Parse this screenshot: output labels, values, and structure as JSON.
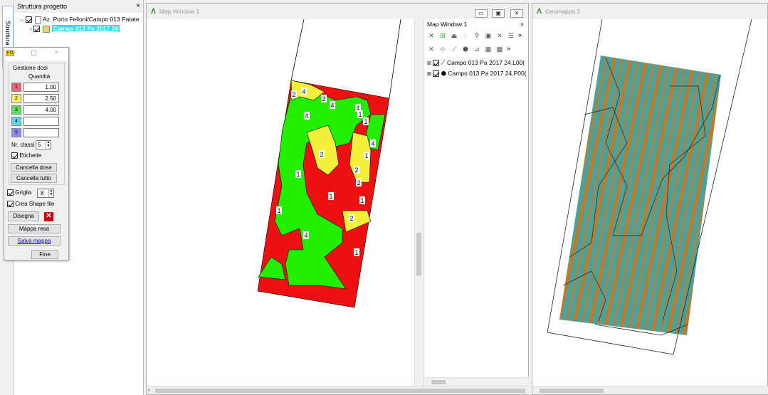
{
  "sidebar_tab": {
    "label": "Struttura p"
  },
  "project_panel": {
    "title": "Struttura progetto",
    "close": "×",
    "tree": [
      {
        "label": "Az. Porto Felloni/Campo 013 Patate"
      },
      {
        "label": "Campo 013 Pa 2017 24"
      }
    ]
  },
  "dose_dialog": {
    "badge": "FO",
    "group_title": "Gestione dosi",
    "qty_header": "Quantità",
    "classes": [
      {
        "n": "1",
        "color": "#e8657a",
        "value": "1.00"
      },
      {
        "n": "2",
        "color": "#f5f066",
        "value": "2.50"
      },
      {
        "n": "3",
        "color": "#5ee05e",
        "value": "4.00"
      },
      {
        "n": "4",
        "color": "#5dd8e8",
        "value": ""
      },
      {
        "n": "5",
        "color": "#8c8cf0",
        "value": ""
      }
    ],
    "nr_classi_label": "Nr. classi",
    "nr_classi_value": "5",
    "etichette_label": "Etichette",
    "cancella_dose": "Cancella dose",
    "cancella_tutto": "Cancella tutto",
    "griglia_label": "Griglia",
    "griglia_value": "8",
    "crea_shape_label": "Crea Shape file",
    "disegna": "Disegna",
    "mappa_resa": "Mappa resa",
    "salva_mappa": "Salva mappa",
    "fine": "Fine"
  },
  "map_window": {
    "title": "Map Window 1",
    "min": "▭",
    "max": "▣",
    "close": "✕"
  },
  "legend_panel": {
    "title": "Map Window 1",
    "close": "×",
    "more": "»",
    "layers": [
      {
        "name": "Campo 013 Pa 2017 24.L00("
      },
      {
        "name": "Campo 013 Pa 2017 24.P00("
      }
    ]
  },
  "geomap": {
    "title": "Geomappa 2"
  },
  "zone_labels": [
    {
      "t": "4"
    },
    {
      "t": "2"
    },
    {
      "t": "2"
    },
    {
      "t": "4"
    },
    {
      "t": "4"
    },
    {
      "t": "4"
    },
    {
      "t": "1"
    },
    {
      "t": "1"
    },
    {
      "t": "2"
    },
    {
      "t": "4"
    },
    {
      "t": "1"
    },
    {
      "t": "2"
    },
    {
      "t": "1"
    },
    {
      "t": "1"
    },
    {
      "t": "1"
    },
    {
      "t": "2"
    },
    {
      "t": "4"
    },
    {
      "t": "1"
    },
    {
      "t": "2"
    },
    {
      "t": "1"
    }
  ],
  "colors": {
    "zone_red": "#ee1111",
    "zone_green": "#22ee00",
    "zone_yellow": "#f3f03a",
    "link": "#0000cc",
    "tree_highlight": "#33ddee"
  }
}
